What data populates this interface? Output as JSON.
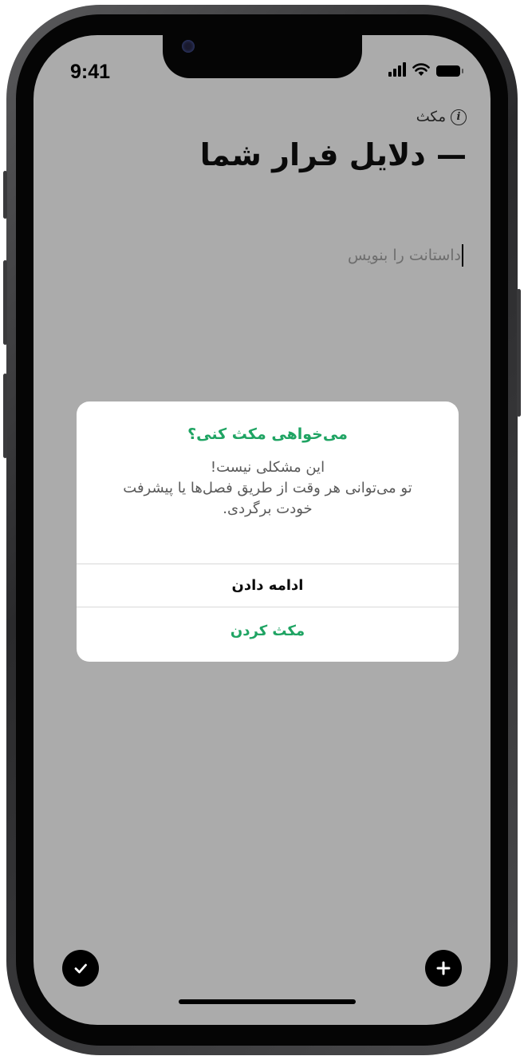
{
  "status_bar": {
    "time": "9:41"
  },
  "header": {
    "exit_label": "مکث",
    "title": "— دلایل فرار شما"
  },
  "editor": {
    "placeholder": "داستانت را بنویس"
  },
  "dialog": {
    "title": "می‌خواهی مکث کنی؟",
    "message_lines": [
      "این مشکلی نیست!",
      "تو می‌توانی هر وقت از طریق فصل‌ها یا پیشرفت",
      "خودت برگردی."
    ],
    "continue_label": "ادامه دادن",
    "pause_label": "مکث کردن"
  },
  "colors": {
    "accent": "#1fa463",
    "overlay": "#ababab"
  },
  "icons": {
    "info": "info-icon",
    "check": "check-icon",
    "add": "plus-icon"
  }
}
